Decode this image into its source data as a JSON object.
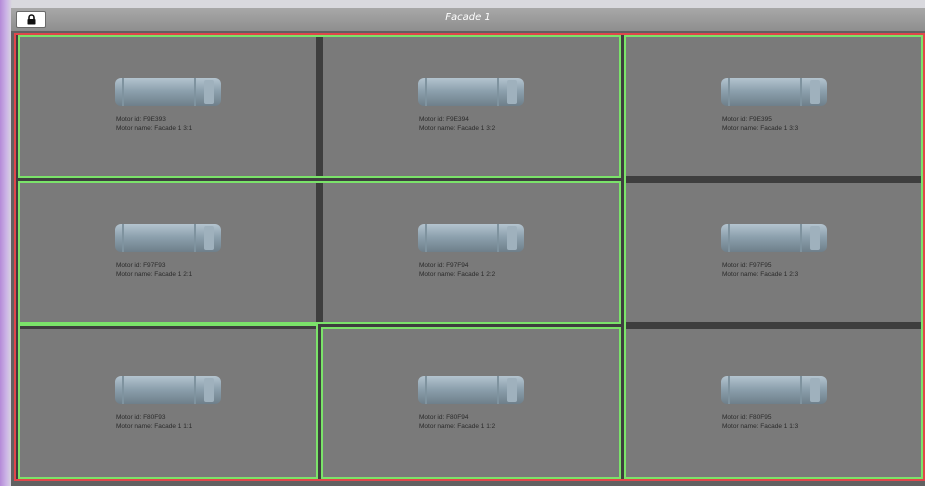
{
  "window": {
    "title": "Facade 1",
    "lock_icon": "padlock-icon"
  },
  "colors": {
    "facade_border": "#e0474b",
    "group_border": "#7be36a",
    "panel_bg": "#7a7a7a",
    "divider": "#3e3e3e"
  },
  "panels": [
    {
      "motor_id": "Motor id: F9E393",
      "motor_name": "Motor name: Facade 1 3:1"
    },
    {
      "motor_id": "Motor id: F9E394",
      "motor_name": "Motor name: Facade 1 3:2"
    },
    {
      "motor_id": "Motor id: F9E395",
      "motor_name": "Motor name: Facade 1 3:3"
    },
    {
      "motor_id": "Motor id: F97F93",
      "motor_name": "Motor name: Facade 1 2:1"
    },
    {
      "motor_id": "Motor id: F97F94",
      "motor_name": "Motor name: Facade 1 2:2"
    },
    {
      "motor_id": "Motor id: F97F95",
      "motor_name": "Motor name: Facade 1 2:3"
    },
    {
      "motor_id": "Motor id: F80F93",
      "motor_name": "Motor name: Facade 1 1:1"
    },
    {
      "motor_id": "Motor id: F80F94",
      "motor_name": "Motor name: Facade 1 1:2"
    },
    {
      "motor_id": "Motor id: F80F95",
      "motor_name": "Motor name: Facade 1 1:3"
    }
  ]
}
